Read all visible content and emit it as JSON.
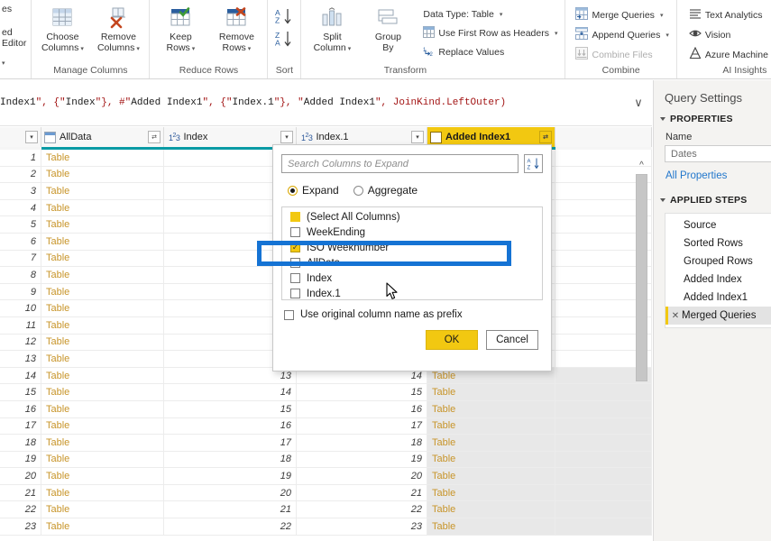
{
  "ribbon": {
    "cut_group": {
      "line1": "es",
      "line2": "ed Editor",
      "caret": "▾"
    },
    "groups": [
      {
        "label": "Manage Columns",
        "buttons": [
          {
            "name": "choose-columns",
            "line1": "Choose",
            "line2": "Columns",
            "icon": "table-columns-icon",
            "has_caret": true
          },
          {
            "name": "remove-columns",
            "line1": "Remove",
            "line2": "Columns",
            "icon": "remove-columns-icon",
            "has_caret": true
          }
        ]
      },
      {
        "label": "Reduce Rows",
        "buttons": [
          {
            "name": "keep-rows",
            "line1": "Keep",
            "line2": "Rows",
            "icon": "keep-rows-icon",
            "has_caret": true
          },
          {
            "name": "remove-rows",
            "line1": "Remove",
            "line2": "Rows",
            "icon": "remove-rows-icon",
            "has_caret": true
          }
        ]
      },
      {
        "label": "Sort",
        "buttons": [
          {
            "name": "sort-ascending",
            "line1": "",
            "line2": "",
            "icon": "sort-az-icon",
            "has_caret": false
          },
          {
            "name": "sort-descending",
            "line1": "",
            "line2": "",
            "icon": "sort-za-icon",
            "has_caret": false
          }
        ]
      },
      {
        "label": "Transform",
        "buttons": [
          {
            "name": "split-column",
            "line1": "Split",
            "line2": "Column",
            "icon": "split-column-icon",
            "has_caret": true
          },
          {
            "name": "group-by",
            "line1": "Group",
            "line2": "By",
            "icon": "group-by-icon",
            "has_caret": false
          }
        ],
        "small_buttons": [
          {
            "name": "data-type",
            "label": "Data Type: Table",
            "icon": "",
            "has_caret": true,
            "disabled": false
          },
          {
            "name": "use-first-row-as-headers",
            "label": "Use First Row as Headers",
            "icon": "first-row-headers-icon",
            "has_caret": true,
            "disabled": false
          },
          {
            "name": "replace-values",
            "label": "Replace Values",
            "icon": "replace-values-icon",
            "has_caret": false,
            "disabled": false
          }
        ]
      },
      {
        "label": "Combine",
        "small_buttons": [
          {
            "name": "merge-queries",
            "label": "Merge Queries",
            "icon": "merge-queries-icon",
            "has_caret": true,
            "disabled": false
          },
          {
            "name": "append-queries",
            "label": "Append Queries",
            "icon": "append-queries-icon",
            "has_caret": true,
            "disabled": false
          },
          {
            "name": "combine-files",
            "label": "Combine Files",
            "icon": "combine-files-icon",
            "has_caret": false,
            "disabled": true
          }
        ]
      },
      {
        "label": "AI Insights",
        "small_buttons": [
          {
            "name": "text-analytics",
            "label": "Text Analytics",
            "icon": "text-analytics-icon",
            "has_caret": false,
            "disabled": false
          },
          {
            "name": "vision",
            "label": "Vision",
            "icon": "vision-eye-icon",
            "has_caret": false,
            "disabled": false
          },
          {
            "name": "azure-machine-learning",
            "label": "Azure Machine Learning",
            "icon": "azure-ml-icon",
            "has_caret": false,
            "disabled": false
          }
        ]
      }
    ]
  },
  "formula_bar": {
    "text": "Index1\", {\"Index\"}, #\"Added Index1\", {\"Index.1\"}, \"Added Index1\", JoinKind.LeftOuter)",
    "chevron": "∨"
  },
  "grid": {
    "columns": [
      {
        "name": "row-number",
        "label": "",
        "type": "rownum",
        "icon": ""
      },
      {
        "name": "alldata",
        "label": "AllData",
        "type": "table",
        "icon": "table-icon",
        "selected": false
      },
      {
        "name": "index",
        "label": "Index",
        "type": "number",
        "icon": "123-icon",
        "selected": false
      },
      {
        "name": "index1",
        "label": "Index.1",
        "type": "number",
        "icon": "123-icon",
        "selected": false
      },
      {
        "name": "added-index1",
        "label": "Added Index1",
        "type": "table",
        "icon": "table-icon",
        "selected": true
      }
    ],
    "rows": [
      {
        "no": "1",
        "alldata": "Table",
        "index": "",
        "index1": "",
        "added": ""
      },
      {
        "no": "2",
        "alldata": "Table",
        "index": "",
        "index1": "",
        "added": ""
      },
      {
        "no": "3",
        "alldata": "Table",
        "index": "",
        "index1": "",
        "added": ""
      },
      {
        "no": "4",
        "alldata": "Table",
        "index": "",
        "index1": "",
        "added": ""
      },
      {
        "no": "5",
        "alldata": "Table",
        "index": "",
        "index1": "",
        "added": ""
      },
      {
        "no": "6",
        "alldata": "Table",
        "index": "",
        "index1": "",
        "added": ""
      },
      {
        "no": "7",
        "alldata": "Table",
        "index": "",
        "index1": "",
        "added": ""
      },
      {
        "no": "8",
        "alldata": "Table",
        "index": "",
        "index1": "",
        "added": ""
      },
      {
        "no": "9",
        "alldata": "Table",
        "index": "",
        "index1": "",
        "added": ""
      },
      {
        "no": "10",
        "alldata": "Table",
        "index": "",
        "index1": "",
        "added": ""
      },
      {
        "no": "11",
        "alldata": "Table",
        "index": "",
        "index1": "",
        "added": ""
      },
      {
        "no": "12",
        "alldata": "Table",
        "index": "",
        "index1": "",
        "added": ""
      },
      {
        "no": "13",
        "alldata": "Table",
        "index": "",
        "index1": "",
        "added": ""
      },
      {
        "no": "14",
        "alldata": "Table",
        "index": "13",
        "index1": "14",
        "added": "Table"
      },
      {
        "no": "15",
        "alldata": "Table",
        "index": "14",
        "index1": "15",
        "added": "Table"
      },
      {
        "no": "16",
        "alldata": "Table",
        "index": "15",
        "index1": "16",
        "added": "Table"
      },
      {
        "no": "17",
        "alldata": "Table",
        "index": "16",
        "index1": "17",
        "added": "Table"
      },
      {
        "no": "18",
        "alldata": "Table",
        "index": "17",
        "index1": "18",
        "added": "Table"
      },
      {
        "no": "19",
        "alldata": "Table",
        "index": "18",
        "index1": "19",
        "added": "Table"
      },
      {
        "no": "20",
        "alldata": "Table",
        "index": "19",
        "index1": "20",
        "added": "Table"
      },
      {
        "no": "21",
        "alldata": "Table",
        "index": "20",
        "index1": "21",
        "added": "Table"
      },
      {
        "no": "22",
        "alldata": "Table",
        "index": "21",
        "index1": "22",
        "added": "Table"
      },
      {
        "no": "23",
        "alldata": "Table",
        "index": "22",
        "index1": "23",
        "added": "Table"
      }
    ]
  },
  "expand_panel": {
    "search_placeholder": "Search Columns to Expand",
    "sort_icon": "sort-az-icon",
    "mode_expand": "Expand",
    "mode_aggregate": "Aggregate",
    "selected_mode": "Expand",
    "columns": [
      {
        "label": "(Select All Columns)",
        "state": "partial"
      },
      {
        "label": "WeekEnding",
        "state": "unchecked"
      },
      {
        "label": "ISO Weeknumber",
        "state": "checked"
      },
      {
        "label": "AllData",
        "state": "unchecked"
      },
      {
        "label": "Index",
        "state": "unchecked"
      },
      {
        "label": "Index.1",
        "state": "unchecked"
      }
    ],
    "prefix_label": "Use original column name as prefix",
    "prefix_checked": false,
    "ok_label": "OK",
    "cancel_label": "Cancel"
  },
  "annotation": {
    "highlight_color": "#1573d4",
    "target": "ISO Weeknumber"
  },
  "sidebar": {
    "title": "Query Settings",
    "properties_header": "PROPERTIES",
    "name_label": "Name",
    "name_value": "Dates",
    "all_properties_link": "All Properties",
    "applied_steps_header": "APPLIED STEPS",
    "steps": [
      {
        "label": "Source",
        "active": false
      },
      {
        "label": "Sorted Rows",
        "active": false
      },
      {
        "label": "Grouped Rows",
        "active": false
      },
      {
        "label": "Added Index",
        "active": false
      },
      {
        "label": "Added Index1",
        "active": false
      },
      {
        "label": "Merged Queries",
        "active": true
      }
    ]
  }
}
